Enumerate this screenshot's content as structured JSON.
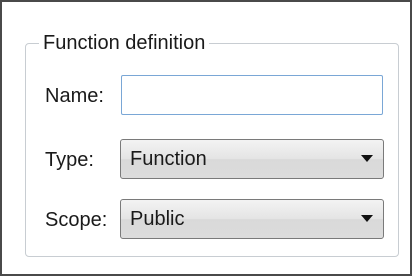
{
  "function_definition": {
    "group_title": "Function definition",
    "name": {
      "label": "Name:",
      "value": ""
    },
    "type": {
      "label": "Type:",
      "selected": "Function"
    },
    "scope": {
      "label": "Scope:",
      "selected": "Public"
    }
  },
  "colors": {
    "frame_border": "#4a4a4a",
    "group_border": "#c8cdd2",
    "input_focus_border": "#7aa7d6"
  }
}
